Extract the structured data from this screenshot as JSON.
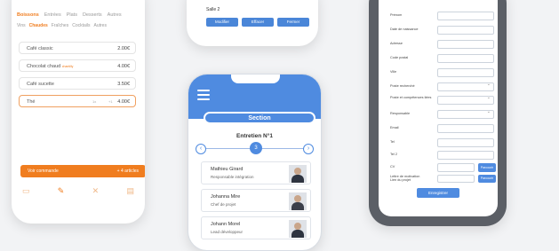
{
  "menu_app": {
    "tabs": [
      "Boissons",
      "Entrées",
      "Plats",
      "Desserts",
      "Autres"
    ],
    "subtabs": [
      "Vins",
      "Chaudes",
      "Fraîches",
      "Cocktails",
      "Autres"
    ],
    "items": [
      {
        "name": "Café classic",
        "tag": "",
        "price": "2.00€"
      },
      {
        "name": "Chocolat chaud",
        "tag": "chantilly",
        "price": "4.00€"
      },
      {
        "name": "Café sucette",
        "tag": "",
        "price": "3.50€"
      },
      {
        "name": "Thé",
        "tag": "",
        "price": "4.00€"
      }
    ],
    "selected_controls": [
      "1x",
      "+1"
    ],
    "order_bar": {
      "left": "Voir commande",
      "right": "+ 4 articles"
    }
  },
  "top_card": {
    "text": "Salle 2",
    "buttons": [
      "Modifier",
      "Effacer",
      "Fermer"
    ]
  },
  "section_app": {
    "title": "Section",
    "entretien": "Entretien N°1",
    "step_number": "3",
    "prev_icon": "‹",
    "next_icon": "›",
    "people": [
      {
        "name": "Mathieu Girard",
        "role": "Responsable intégration"
      },
      {
        "name": "Johanna Mire",
        "role": "Chef de projet"
      },
      {
        "name": "Johann Morel",
        "role": "Lead développeur"
      }
    ]
  },
  "form_app": {
    "fields": [
      {
        "label": "Prénom",
        "type": "text"
      },
      {
        "label": "Date de naissance",
        "type": "text"
      },
      {
        "label": "Adresse",
        "type": "text"
      },
      {
        "label": "Code postal",
        "type": "text"
      },
      {
        "label": "Ville",
        "type": "text"
      },
      {
        "label": "Poste recherché",
        "type": "select"
      },
      {
        "label": "Poste et compétences liées",
        "type": "select"
      },
      {
        "label": "Responsable",
        "type": "select"
      },
      {
        "label": "Email",
        "type": "text"
      },
      {
        "label": "Tel",
        "type": "text"
      },
      {
        "label": "Tel 2",
        "type": "text"
      },
      {
        "label": "CV",
        "type": "file"
      },
      {
        "label": "Lettre de motivation",
        "type": "file"
      },
      {
        "label": "Lien du projet",
        "type": "text"
      }
    ],
    "browse_label": "Parcourir",
    "submit_label": "Enregistrer"
  }
}
